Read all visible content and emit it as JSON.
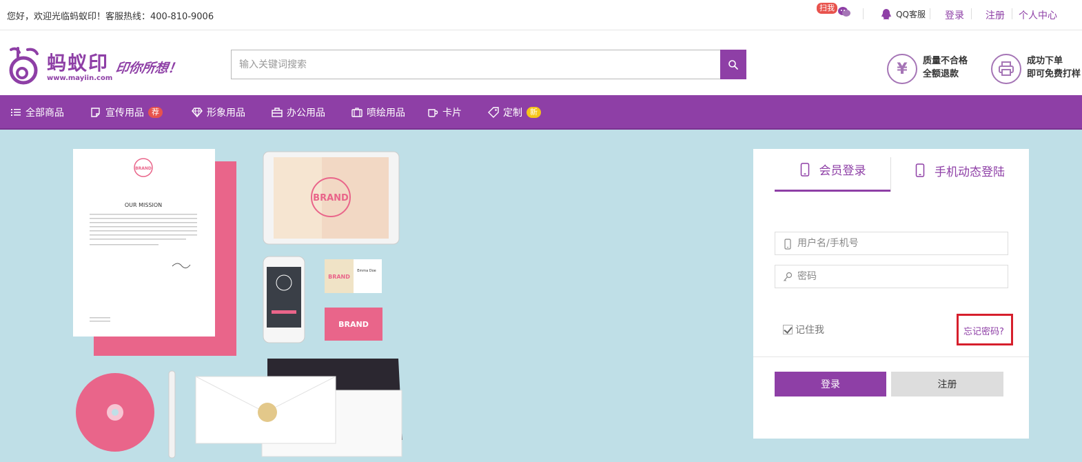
{
  "topbar": {
    "welcome": "您好，欢迎光临蚂蚁印！客服热线：400-810-9006",
    "scan_badge": "扫我",
    "qq_label": "QQ客服",
    "login_link": "登录",
    "register_link": "注册",
    "user_center": "个人中心"
  },
  "header": {
    "logo_text": "蚂蚁印",
    "logo_url": "www.mayiin.com",
    "slogan": "印你所想！",
    "search_placeholder": "输入关键词搜索",
    "promises": [
      {
        "icon": "¥",
        "line1": "质量不合格",
        "line2": "全额退款"
      },
      {
        "icon": "printer",
        "line1": "成功下单",
        "line2": "即可免费打样"
      }
    ]
  },
  "nav": {
    "items": [
      {
        "label": "全部商品",
        "icon": "list-icon"
      },
      {
        "label": "宣传用品",
        "icon": "note-icon",
        "badge": "荐"
      },
      {
        "label": "形象用品",
        "icon": "diamond-icon"
      },
      {
        "label": "办公用品",
        "icon": "briefcase-icon"
      },
      {
        "label": "喷绘用品",
        "icon": "suitcase-icon"
      },
      {
        "label": "卡片",
        "icon": "cup-icon"
      },
      {
        "label": "定制",
        "icon": "tag-icon",
        "badge": "新"
      }
    ]
  },
  "banner": {
    "mission_title": "OUR MISSION",
    "brand": "BRAND",
    "card_name": "Emma Doe"
  },
  "login": {
    "tab_member": "会员登录",
    "tab_mobile": "手机动态登陆",
    "username_placeholder": "用户名/手机号",
    "password_placeholder": "密码",
    "remember": "记住我",
    "forgot": "忘记密码?",
    "login_button": "登录",
    "register_button": "注册"
  },
  "colors": {
    "brand_purple": "#8e3fa6",
    "banner_bg": "#bfdfe7",
    "highlight_red": "#d61f2c"
  }
}
